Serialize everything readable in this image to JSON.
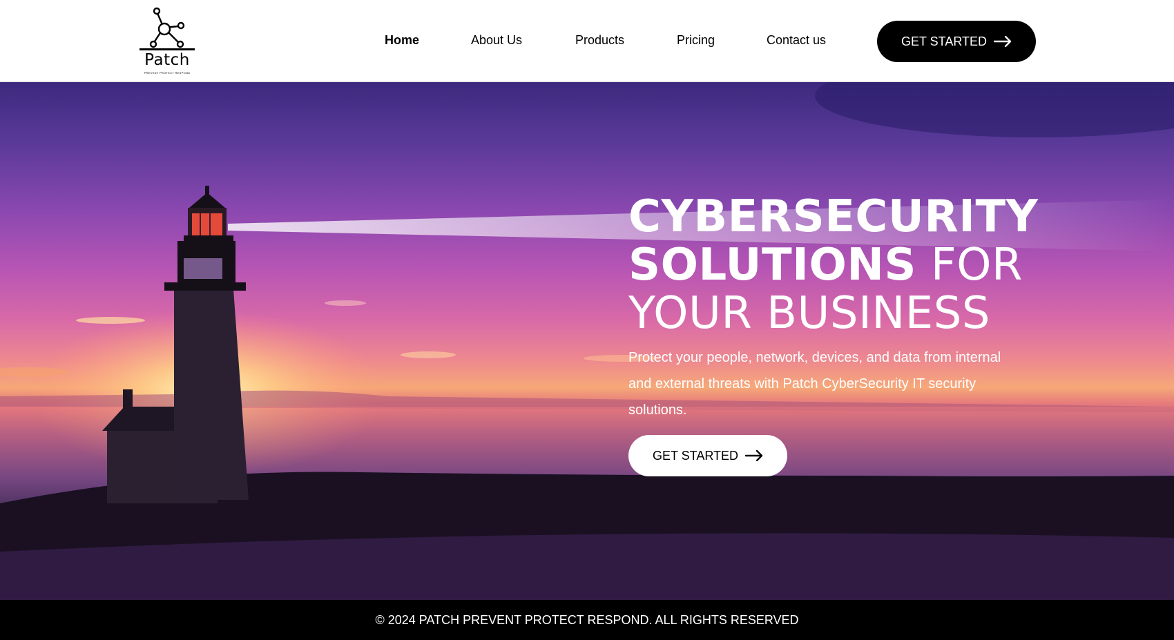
{
  "brand": {
    "name": "Patch",
    "tagline": "PREVENT PROTECT RESPOND"
  },
  "nav": {
    "items": [
      {
        "label": "Home",
        "active": true
      },
      {
        "label": "About Us",
        "active": false
      },
      {
        "label": "Products",
        "active": false
      },
      {
        "label": "Pricing",
        "active": false
      },
      {
        "label": "Contact us",
        "active": false
      }
    ],
    "cta_label": "GET STARTED"
  },
  "hero": {
    "title_bold_1": "CYBERSECURITY",
    "title_bold_2": "SOLUTIONS",
    "title_light_1": "FOR",
    "title_light_2": "YOUR BUSINESS",
    "description": "Protect your people, network, devices, and data from internal and external threats with Patch CyberSecurity IT security solutions.",
    "cta_label": "GET STARTED",
    "background_image": "lighthouse-sunset"
  },
  "footer": {
    "copyright": "© 2024 PATCH PREVENT PROTECT RESPOND. ALL RIGHTS RESERVED"
  },
  "icons": {
    "logo": "network-nodes-icon",
    "cta_arrow": "arrow-right-icon"
  },
  "colors": {
    "header_bg": "#ffffff",
    "cta_dark": "#000000",
    "cta_light": "#ffffff",
    "footer_bg": "#000000"
  }
}
